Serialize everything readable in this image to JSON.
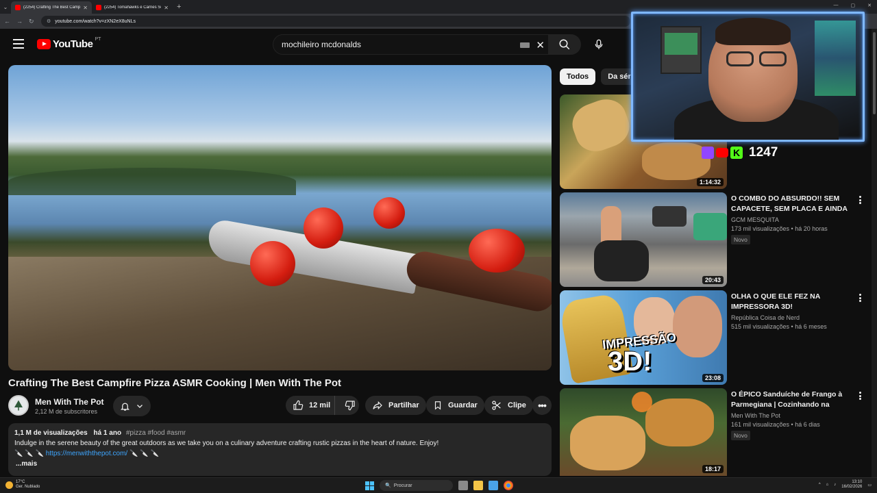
{
  "browser": {
    "tabs": [
      {
        "title": "(2254) Crafting The Best Campfi"
      },
      {
        "title": "(2254) Tomahawks e Carnes Se"
      }
    ],
    "url": "youtube.com/watch?v=zXN2eX8uNLs"
  },
  "header": {
    "logo_text": "YouTube",
    "country_code": "PT",
    "search_value": "mochileiro mcdonalds"
  },
  "video": {
    "title": "Crafting The Best Campfire Pizza ASMR Cooking | Men With The Pot",
    "channel": "Men With The Pot",
    "subscribers": "2,12 M de subscritores",
    "likes": "12 mil",
    "share_label": "Partilhar",
    "save_label": "Guardar",
    "clip_label": "Clipe",
    "description": {
      "views": "1,1 M de visualizações",
      "age": "há 1 ano",
      "tags": "#pizza #food #asmr",
      "text": "Indulge in the serene beauty of the great outdoors as we take you on a culinary adventure crafting rustic pizzas in the heart of nature. Enjoy!",
      "link": "https://menwiththepot.com/",
      "more": "...mais"
    }
  },
  "chips": [
    "Todos",
    "Da série"
  ],
  "recommendations": [
    {
      "title": "",
      "channel": "",
      "meta": "",
      "duration": "1:14:32",
      "badge": ""
    },
    {
      "title": "O COMBO DO ABSURDO!! SEM CAPACETE, SEM PLACA E AINDA ...",
      "channel": "GCM MESQUITA",
      "meta": "173 mil visualizações • há 20 horas",
      "duration": "20:43",
      "badge": "Novo"
    },
    {
      "title": "OLHA O QUE ELE FEZ NA IMPRESSORA 3D!",
      "channel": "República Coisa de Nerd",
      "meta": "515 mil visualizações • há 6 meses",
      "duration": "23:08",
      "badge": ""
    },
    {
      "title": "O ÉPICO Sanduíche de Frango à Parmegiana | Cozinhando na Floresta",
      "channel": "Men With The Pot",
      "meta": "161 mil visualizações • há 6 dias",
      "duration": "18:17",
      "badge": "Novo"
    }
  ],
  "overlay": {
    "counter": "1247",
    "thumb_text": "IMPRESSÃO",
    "thumb_text2": "3D!"
  },
  "taskbar": {
    "temp": "17°C",
    "weather": "Ger. Nublado",
    "search_placeholder": "Procurar",
    "time": "13:10",
    "date": "16/02/2026"
  },
  "colors": {
    "background": "#0f0f0f",
    "accent_red": "#ff0000",
    "link_blue": "#3ea6ff"
  }
}
